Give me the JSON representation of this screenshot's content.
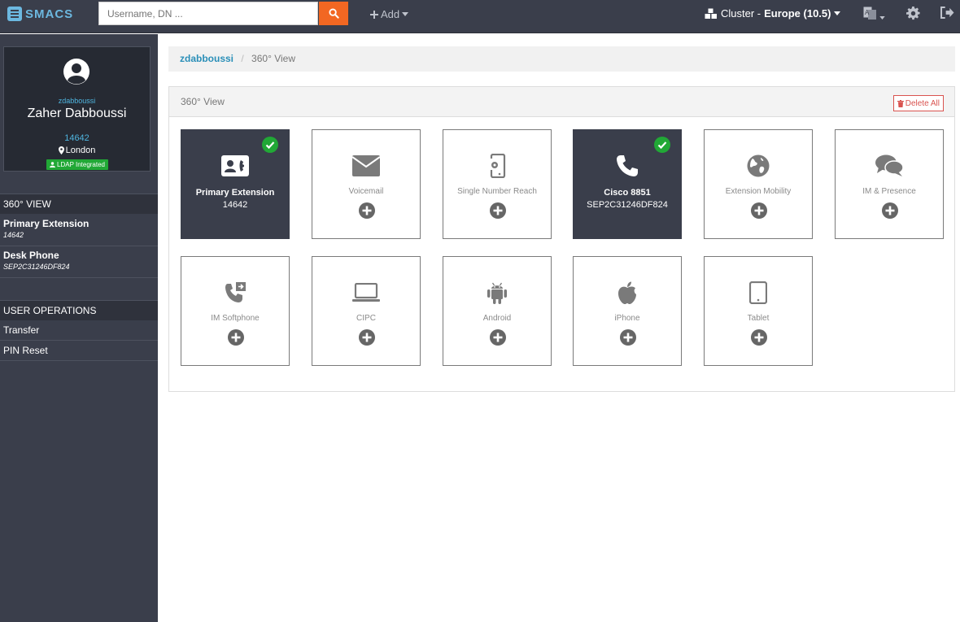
{
  "app": {
    "logo_text": "SMACS"
  },
  "header": {
    "search_placeholder": "Username, DN ...",
    "add_label": "Add",
    "cluster_prefix": "Cluster - ",
    "cluster_name": "Europe (10.5)"
  },
  "profile": {
    "username": "zdabboussi",
    "full_name": "Zaher Dabboussi",
    "extension": "14642",
    "location": "London",
    "badge": "LDAP Integrated"
  },
  "sidebar": {
    "view_header": "360° VIEW",
    "items": [
      {
        "title": "Primary Extension",
        "subtitle": "14642"
      },
      {
        "title": "Desk Phone",
        "subtitle": "SEP2C31246DF824"
      }
    ],
    "ops_header": "USER OPERATIONS",
    "ops": [
      "Transfer",
      "PIN Reset"
    ]
  },
  "breadcrumb": {
    "user": "zdabboussi",
    "current": "360° View"
  },
  "panel": {
    "title": "360° View",
    "delete_all": "Delete All",
    "tiles": [
      {
        "label": "Primary Extension",
        "sub": "14642",
        "icon": "contact-card-icon",
        "active": true
      },
      {
        "label": "Voicemail",
        "icon": "envelope-icon",
        "active": false
      },
      {
        "label": "Single Number Reach",
        "icon": "mobile-gear-icon",
        "active": false
      },
      {
        "label": "Cisco 8851",
        "sub": "SEP2C31246DF824",
        "icon": "phone-icon",
        "active": true
      },
      {
        "label": "Extension Mobility",
        "icon": "globe-icon",
        "active": false
      },
      {
        "label": "IM & Presence",
        "icon": "chat-bubbles-icon",
        "active": false
      },
      {
        "label": "IM Softphone",
        "icon": "phone-forward-icon",
        "active": false
      },
      {
        "label": "CIPC",
        "icon": "laptop-icon",
        "active": false
      },
      {
        "label": "Android",
        "icon": "android-icon",
        "active": false
      },
      {
        "label": "iPhone",
        "icon": "apple-icon",
        "active": false
      },
      {
        "label": "Tablet",
        "icon": "tablet-icon",
        "active": false
      }
    ]
  },
  "colors": {
    "accent": "#f26722",
    "sidebar": "#3a3e4b",
    "success": "#21a836",
    "danger": "#d9534f",
    "link": "#2a8fb8"
  }
}
